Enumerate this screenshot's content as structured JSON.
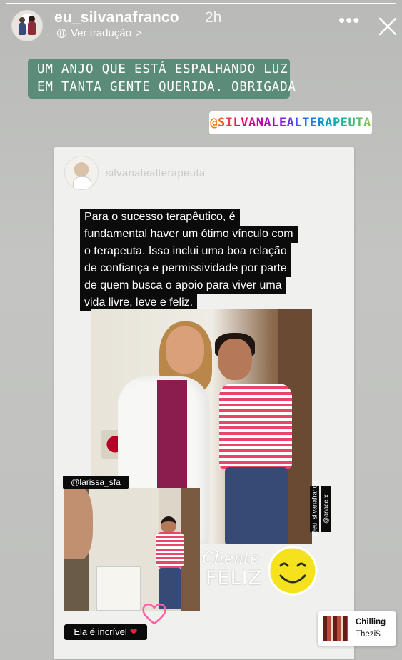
{
  "story": {
    "progress": 1.0,
    "header": {
      "username": "eu_silvanafranco",
      "time_ago": "2h",
      "translate_label": "Ver tradução",
      "translate_chevron": ">",
      "more_icon": "more-horizontal-icon",
      "close_icon": "close-icon"
    },
    "caption": {
      "line1": "UM ANJO QUE ESTÁ ESPALHANDO LUZ",
      "line2": "EM TANTA GENTE QUERIDA. OBRIGADA",
      "background": "#5b8c7a"
    },
    "mention": "@SILVANALEALTERAPEUTA",
    "shared_post": {
      "username": "silvanalealterapeuta",
      "quote_lines": [
        "Para o sucesso terapêutico, é",
        "fundamental haver um ótimo vínculo com",
        "o terapeuta. Isso inclui uma boa relação",
        "de confiança e permissividade por parte",
        "de quem busca o apoio para viver uma",
        "vida livre, leve e feliz."
      ],
      "tags": {
        "larissa": "@larissa_sfa",
        "vertical_1": "@eu_silvanafranco",
        "vertical_2": "@anace.x"
      },
      "sticker_cliente": "Cliente",
      "sticker_feliz": "FELIZ",
      "ela_label": "Ela é incrível",
      "ela_heart": "❤"
    },
    "music": {
      "title": "Chilling",
      "artist": "Thezi$"
    }
  }
}
